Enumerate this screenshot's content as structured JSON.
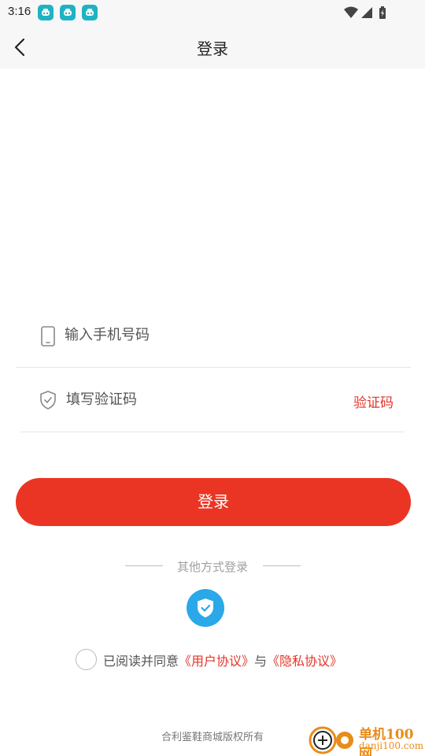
{
  "status_bar": {
    "time": "3:16",
    "notification_icons": [
      "app-notification-icon",
      "app-notification-icon",
      "app-notification-icon"
    ],
    "right_icons": [
      "wifi-icon",
      "signal-icon",
      "battery-charging-icon"
    ]
  },
  "header": {
    "title": "登录",
    "back_icon": "chevron-left-icon"
  },
  "form": {
    "phone": {
      "placeholder": "输入手机号码",
      "value": "",
      "icon": "phone-icon"
    },
    "code": {
      "placeholder": "填写验证码",
      "value": "",
      "icon": "shield-check-icon",
      "get_code_label": "验证码"
    }
  },
  "login_button": {
    "label": "登录"
  },
  "other_login": {
    "label": "其他方式登录",
    "methods": [
      {
        "icon": "shield-check-icon"
      }
    ]
  },
  "agreement": {
    "prefix": "已阅读并同意",
    "user_agreement": "《用户协议》",
    "connector": "与",
    "privacy_policy": "《隐私协议》",
    "checked": false
  },
  "footer": {
    "copyright": "合利鉴鞋商城版权所有"
  },
  "watermark": {
    "name": "单机100网",
    "url": "danji100.com"
  },
  "colors": {
    "accent": "#eb3524",
    "link": "#e3352a",
    "auth_icon_bg": "#2aa8e8",
    "bar_bg": "#f7f7f7"
  }
}
